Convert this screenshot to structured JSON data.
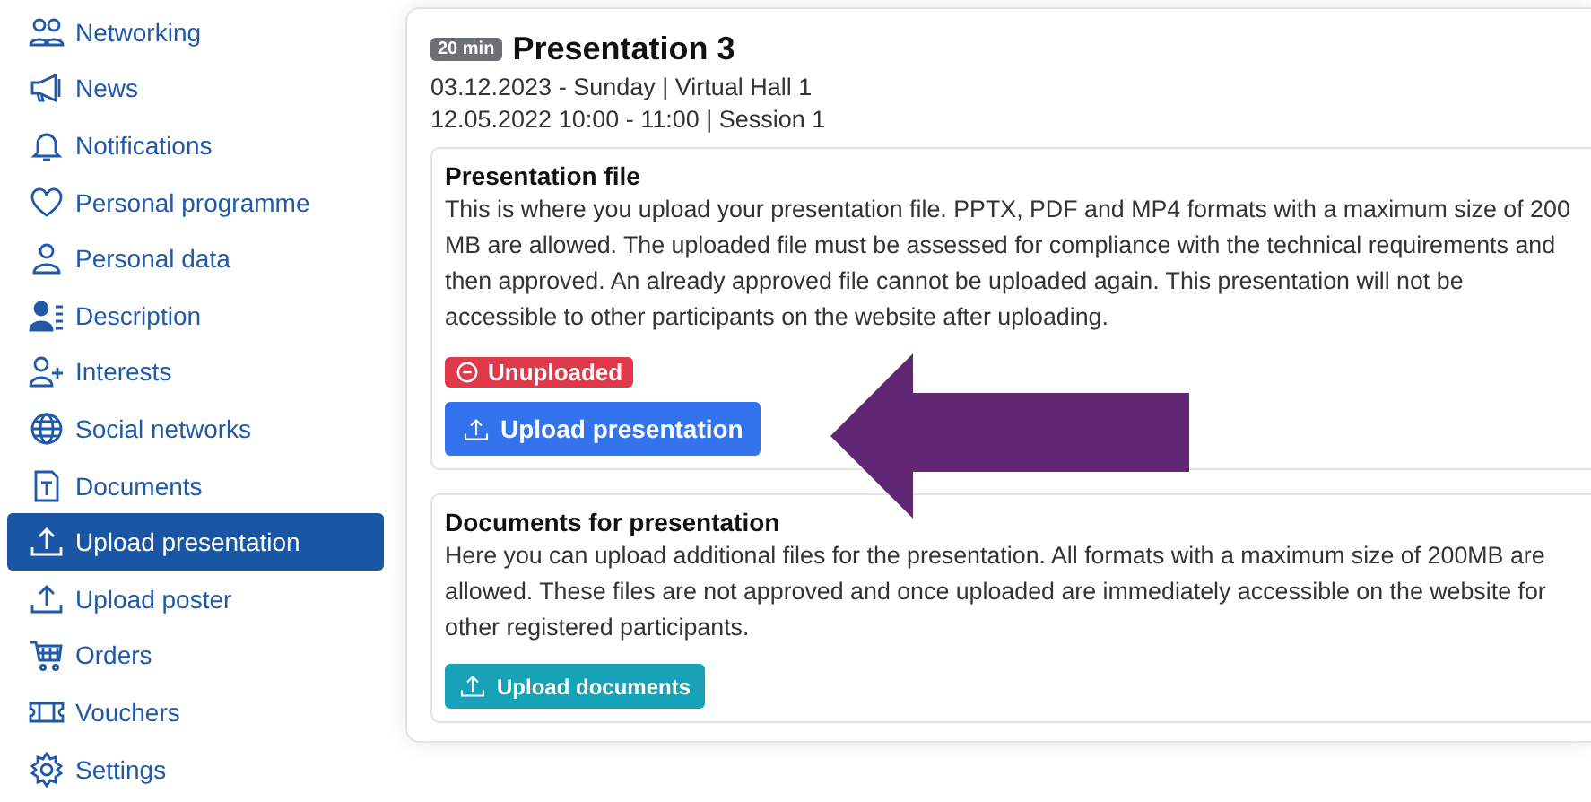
{
  "sidebar": {
    "items": [
      {
        "label": "Networking",
        "kind": "people",
        "selected": false
      },
      {
        "label": "News",
        "kind": "megaphone",
        "selected": false
      },
      {
        "label": "Notifications",
        "kind": "bell",
        "selected": false
      },
      {
        "label": "Personal programme",
        "kind": "heart",
        "selected": false
      },
      {
        "label": "Personal data",
        "kind": "person",
        "selected": false
      },
      {
        "label": "Description",
        "kind": "person-list",
        "selected": false
      },
      {
        "label": "Interests",
        "kind": "person-plus",
        "selected": false
      },
      {
        "label": "Social networks",
        "kind": "globe",
        "selected": false
      },
      {
        "label": "Documents",
        "kind": "document",
        "selected": false
      },
      {
        "label": "Upload presentation",
        "kind": "upload",
        "selected": true
      },
      {
        "label": "Upload poster",
        "kind": "upload",
        "selected": false
      },
      {
        "label": "Orders",
        "kind": "cart",
        "selected": false
      },
      {
        "label": "Vouchers",
        "kind": "ticket",
        "selected": false
      },
      {
        "label": "Settings",
        "kind": "gear",
        "selected": false
      }
    ]
  },
  "presentation": {
    "duration": "20 min",
    "title": "Presentation 3",
    "line_1": "03.12.2023 - Sunday | Virtual Hall 1",
    "line_2": "12.05.2022 10:00 - 11:00 | Session 1",
    "sections": [
      {
        "title": "Presentation file",
        "text": "This is where you upload your presentation file. PPTX, PDF and MP4 formats with a maximum size of 200 MB are allowed. The uploaded file must be assessed for compliance with the technical requirements and then approved. An already approved file cannot be uploaded again. This presentation will not be accessible to other participants on the website after uploading.",
        "status": "Unuploaded",
        "button": {
          "label": "Upload presentation",
          "kind": "primary"
        }
      },
      {
        "title": "Documents for presentation",
        "text": "Here you can upload additional files for the presentation. All formats with a maximum size of 200MB are allowed. These files are not approved and once uploaded are immediately accessible on the website for other registered participants.",
        "button": {
          "label": "Upload documents",
          "kind": "secondary"
        }
      }
    ]
  }
}
